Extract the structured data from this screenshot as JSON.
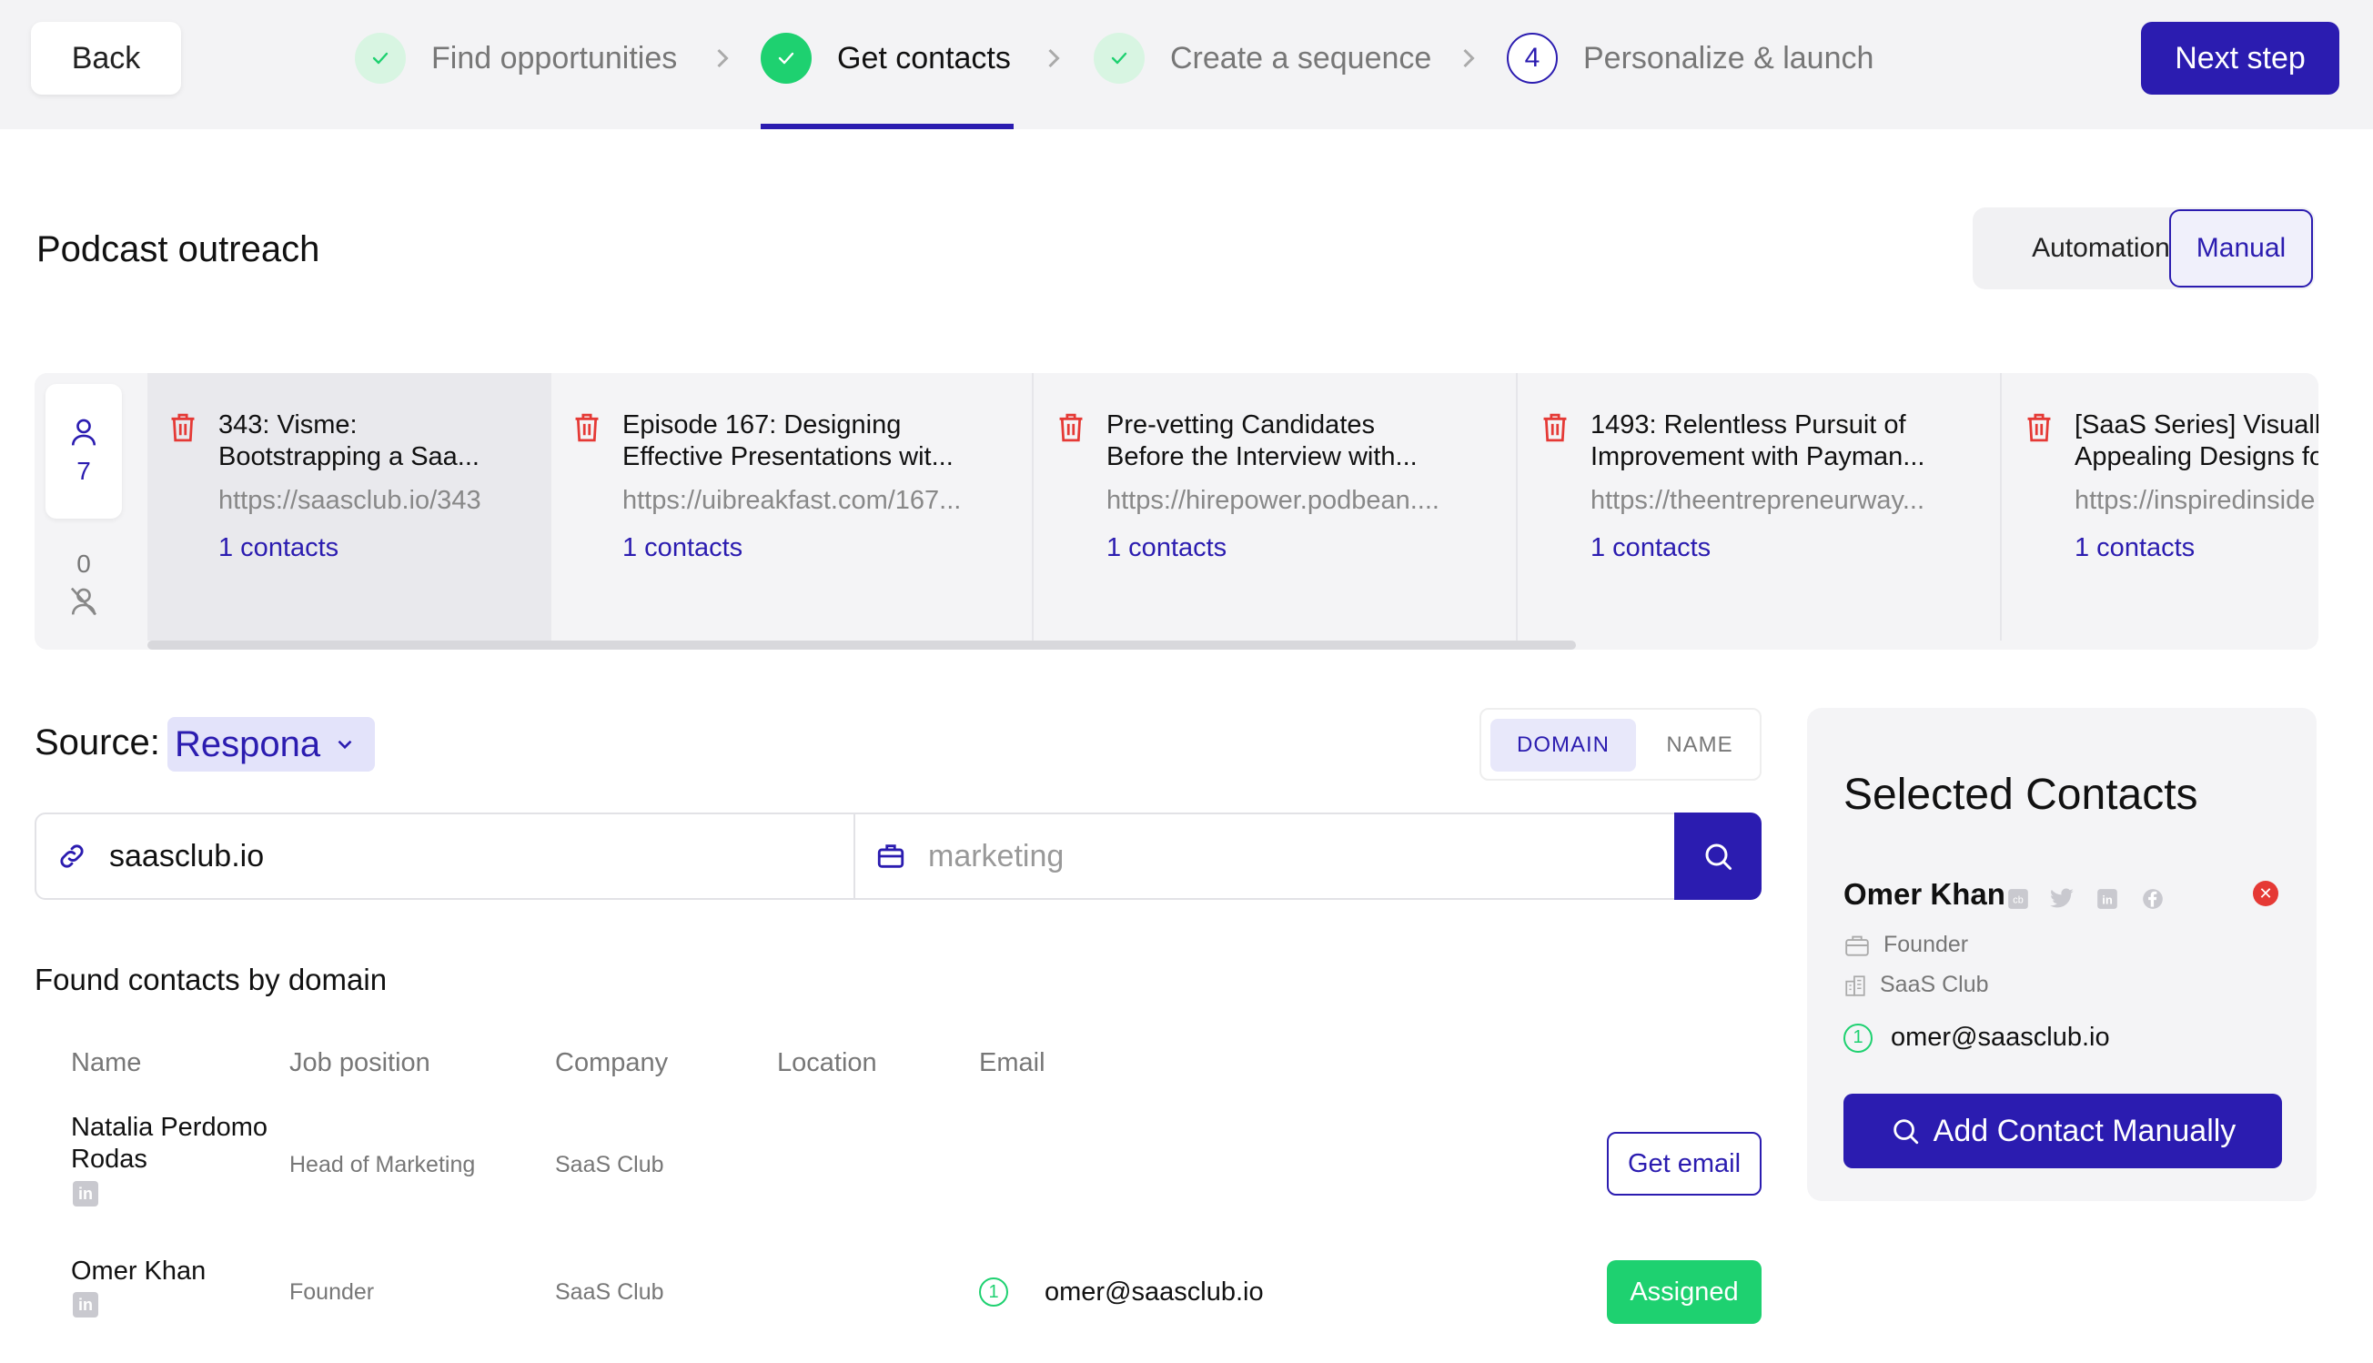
{
  "topbar": {
    "back_label": "Back",
    "next_label": "Next step",
    "steps": [
      {
        "label": "Find opportunities",
        "state": "done"
      },
      {
        "label": "Get contacts",
        "state": "active"
      },
      {
        "label": "Create a sequence",
        "state": "done"
      },
      {
        "label": "Personalize & launch",
        "state": "pending",
        "number": "4"
      }
    ]
  },
  "header": {
    "title": "Podcast outreach",
    "mode_automation": "Automation",
    "mode_manual": "Manual"
  },
  "counts": {
    "with_contacts": "7",
    "without_contacts": "0"
  },
  "opportunities": [
    {
      "title_1": "343: Visme:",
      "title_2": "Bootstrapping a Saa...",
      "url": "https://saasclub.io/343",
      "contacts": "1 contacts"
    },
    {
      "title_1": "Episode 167: Designing",
      "title_2": "Effective Presentations wit...",
      "url": "https://uibreakfast.com/167...",
      "contacts": "1 contacts"
    },
    {
      "title_1": "Pre-vetting Candidates",
      "title_2": "Before the Interview with...",
      "url": "https://hirepower.podbean....",
      "contacts": "1 contacts"
    },
    {
      "title_1": "1493: Relentless Pursuit of",
      "title_2": "Improvement with Payman...",
      "url": "https://theentrepreneurway...",
      "contacts": "1 contacts"
    },
    {
      "title_1": "[SaaS Series] Visually",
      "title_2": "Appealing Designs fo",
      "url": "https://inspiredinside",
      "contacts": "1 contacts"
    }
  ],
  "source": {
    "label": "Source:",
    "value": "Respona",
    "mode_domain": "DOMAIN",
    "mode_name": "NAME"
  },
  "search": {
    "domain_value": "saasclub.io",
    "keyword_placeholder": "marketing"
  },
  "found": {
    "title": "Found contacts by domain",
    "columns": [
      "Name",
      "Job position",
      "Company",
      "Location",
      "Email"
    ],
    "rows": [
      {
        "name_1": "Natalia Perdomo",
        "name_2": "Rodas",
        "position": "Head of Marketing",
        "company": "SaaS Club",
        "location": "",
        "email": "",
        "action": "Get email"
      },
      {
        "name_1": "Omer Khan",
        "name_2": "",
        "position": "Founder",
        "company": "SaaS Club",
        "location": "",
        "email": "omer@saasclub.io",
        "badge": "1",
        "action": "Assigned"
      }
    ]
  },
  "selected": {
    "title": "Selected Contacts",
    "name": "Omer Khan",
    "position": "Founder",
    "company": "SaaS Club",
    "badge": "1",
    "email": "omer@saasclub.io",
    "add_label": "Add Contact Manually"
  },
  "colors": {
    "accent": "#2b1cb0",
    "success": "#1ed170",
    "danger": "#e53935"
  }
}
